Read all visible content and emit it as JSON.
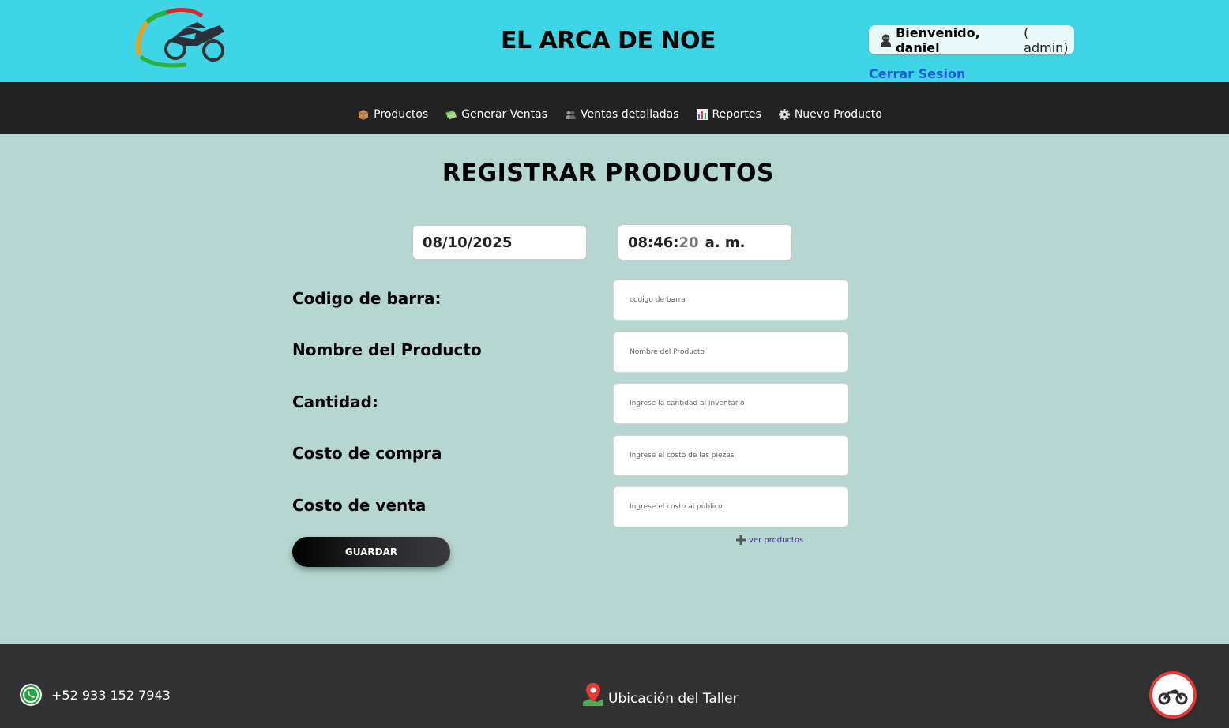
{
  "header": {
    "site_title": "EL ARCA DE NOE",
    "welcome_prefix": "Bienvenido, daniel",
    "welcome_role": "( admin)",
    "logout_label": "Cerrar Sesion"
  },
  "nav": {
    "items": [
      {
        "label": "Productos",
        "icon": "box-icon"
      },
      {
        "label": "Generar Ventas",
        "icon": "money-icon"
      },
      {
        "label": "Ventas detalladas",
        "icon": "people-icon"
      },
      {
        "label": "Reportes",
        "icon": "bar-chart-icon"
      },
      {
        "label": "Nuevo Producto",
        "icon": "gear-icon"
      }
    ]
  },
  "main": {
    "title": "REGISTRAR PRODUCTOS",
    "date": "08/10/2025",
    "time_hm": "08:46:",
    "time_sec": "20",
    "time_ampm": "a. m.",
    "fields": [
      {
        "label": "Codigo de barra:",
        "placeholder": "codigo de barra"
      },
      {
        "label": "Nombre del Producto",
        "placeholder": "Nombre del Producto"
      },
      {
        "label": "Cantidad:",
        "placeholder": "Ingrese la cantidad al inventario"
      },
      {
        "label": "Costo de compra",
        "placeholder": "Ingrese el costo de las piezas"
      },
      {
        "label": "Costo de venta",
        "placeholder": "Ingrese el costo al publico"
      }
    ],
    "save_label": "GUARDAR",
    "view_products_label": "ver productos"
  },
  "footer": {
    "phone": "+52 933 152 7943",
    "location_label": "Ubicación del Taller"
  },
  "colors": {
    "header_bg": "#3ed5e6",
    "nav_bg": "#222222",
    "main_bg": "#b5d6d1",
    "footer_bg": "#323232",
    "link_blue": "#1a5fd6"
  }
}
